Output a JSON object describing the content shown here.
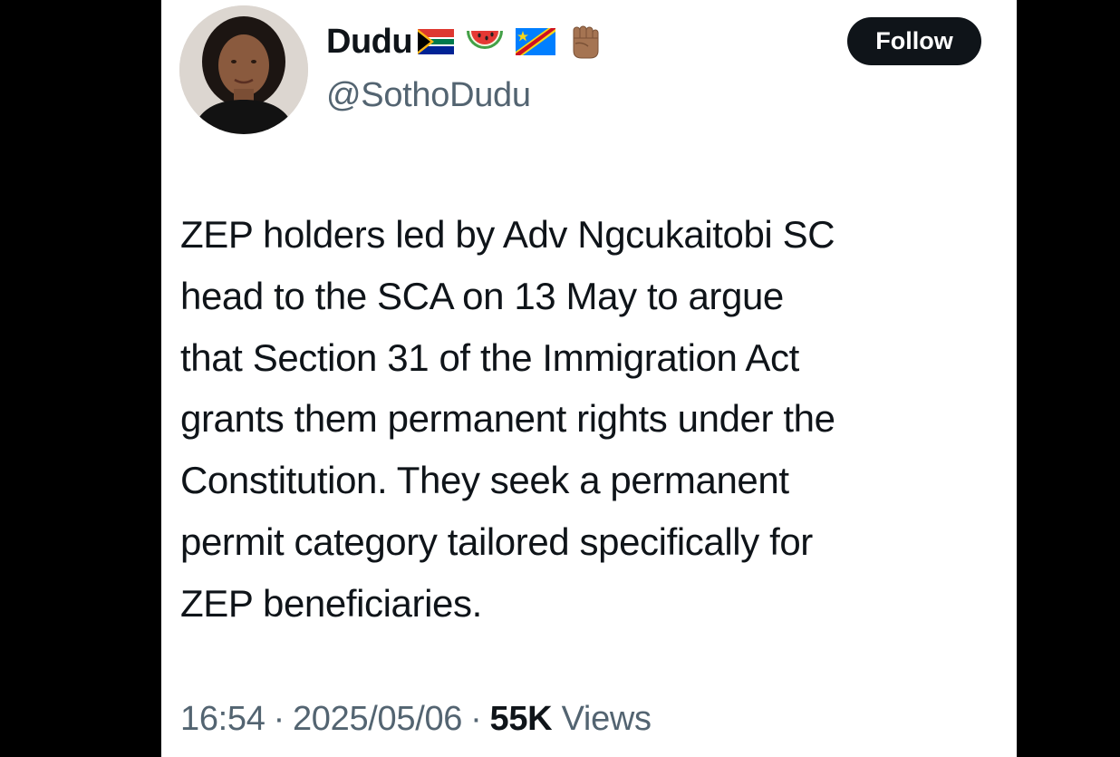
{
  "tweet": {
    "author": {
      "display_name": "Dudu",
      "handle": "@SothoDudu",
      "name_emojis": [
        "south-africa-flag-icon",
        "watermelon-icon",
        "drc-flag-icon",
        "raised-fist-icon"
      ]
    },
    "follow_label": "Follow",
    "text_lines": [
      "ZEP holders led by Adv Ngcukaitobi SC",
      "head to the SCA on 13 May to argue",
      "that Section 31 of the Immigration Act",
      "grants them permanent rights under the",
      "Constitution. They seek a permanent",
      "permit category tailored specifically for",
      "ZEP beneficiaries."
    ],
    "time": "16:54",
    "separator": "·",
    "date": "2025/05/06",
    "views_count": "55K",
    "views_label": "Views"
  },
  "colors": {
    "background": "#000000",
    "card": "#ffffff",
    "text_primary": "#0f1419",
    "text_secondary": "#536471",
    "follow_button": "#0f1419"
  }
}
